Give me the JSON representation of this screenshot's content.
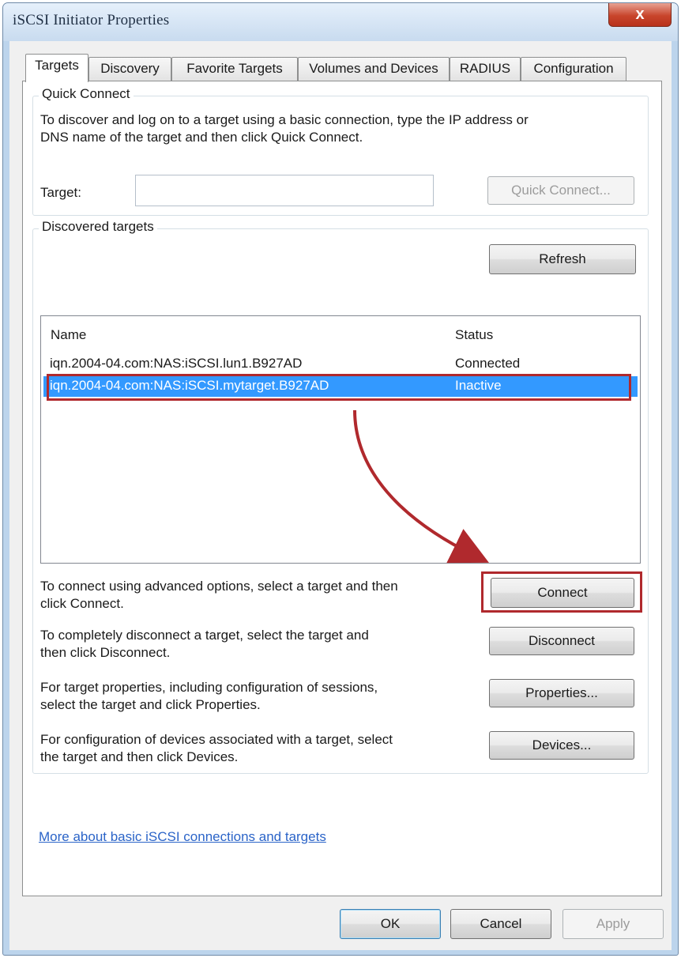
{
  "window": {
    "title": "iSCSI Initiator Properties",
    "close_label": "x"
  },
  "tabs": [
    {
      "label": "Targets",
      "active": true
    },
    {
      "label": "Discovery",
      "active": false
    },
    {
      "label": "Favorite Targets",
      "active": false
    },
    {
      "label": "Volumes and Devices",
      "active": false
    },
    {
      "label": "RADIUS",
      "active": false
    },
    {
      "label": "Configuration",
      "active": false
    }
  ],
  "quick_connect": {
    "group_label": "Quick Connect",
    "description_line1": "To discover and log on to a target using a basic connection, type the IP address or",
    "description_line2": "DNS name of the target and then click Quick Connect.",
    "target_label": "Target:",
    "target_value": "",
    "button_label": "Quick Connect..."
  },
  "discovered": {
    "group_label": "Discovered targets",
    "refresh_label": "Refresh",
    "columns": [
      "Name",
      "Status"
    ],
    "rows": [
      {
        "name": "iqn.2004-04.com:NAS:iSCSI.lun1.B927AD",
        "status": "Connected",
        "selected": false
      },
      {
        "name": "iqn.2004-04.com:NAS:iSCSI.mytarget.B927AD",
        "status": "Inactive",
        "selected": true
      }
    ],
    "connect_text_line1": "To connect using advanced options, select a target and then",
    "connect_text_line2": "click Connect.",
    "connect_label": "Connect",
    "disconnect_text_line1": "To completely disconnect a target, select the target and",
    "disconnect_text_line2": "then click Disconnect.",
    "disconnect_label": "Disconnect",
    "properties_text_line1": "For target properties, including configuration of sessions,",
    "properties_text_line2": "select the target and click Properties.",
    "properties_label": "Properties...",
    "devices_text_line1": "For configuration of devices associated with a target, select",
    "devices_text_line2": "the target and then click Devices.",
    "devices_label": "Devices..."
  },
  "help_link": "More about basic iSCSI connections and targets",
  "footer": {
    "ok_label": "OK",
    "cancel_label": "Cancel",
    "apply_label": "Apply"
  },
  "colors": {
    "selection": "#3399ff",
    "annotation": "#b0292d",
    "link": "#2b64c8"
  },
  "icons": [
    "close-icon",
    "arrow-annotation-icon"
  ]
}
